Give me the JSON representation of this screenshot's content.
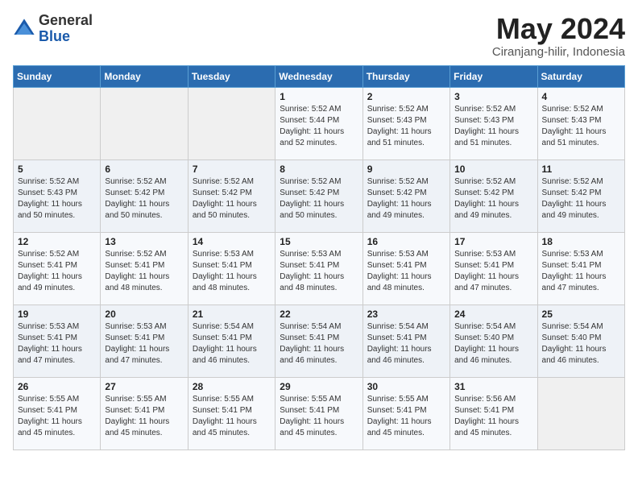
{
  "logo": {
    "general": "General",
    "blue": "Blue"
  },
  "title": "May 2024",
  "subtitle": "Ciranjang-hilir, Indonesia",
  "days": [
    "Sunday",
    "Monday",
    "Tuesday",
    "Wednesday",
    "Thursday",
    "Friday",
    "Saturday"
  ],
  "weeks": [
    [
      {
        "day": "",
        "content": ""
      },
      {
        "day": "",
        "content": ""
      },
      {
        "day": "",
        "content": ""
      },
      {
        "day": "1",
        "content": "Sunrise: 5:52 AM\nSunset: 5:44 PM\nDaylight: 11 hours\nand 52 minutes."
      },
      {
        "day": "2",
        "content": "Sunrise: 5:52 AM\nSunset: 5:43 PM\nDaylight: 11 hours\nand 51 minutes."
      },
      {
        "day": "3",
        "content": "Sunrise: 5:52 AM\nSunset: 5:43 PM\nDaylight: 11 hours\nand 51 minutes."
      },
      {
        "day": "4",
        "content": "Sunrise: 5:52 AM\nSunset: 5:43 PM\nDaylight: 11 hours\nand 51 minutes."
      }
    ],
    [
      {
        "day": "5",
        "content": "Sunrise: 5:52 AM\nSunset: 5:43 PM\nDaylight: 11 hours\nand 50 minutes."
      },
      {
        "day": "6",
        "content": "Sunrise: 5:52 AM\nSunset: 5:42 PM\nDaylight: 11 hours\nand 50 minutes."
      },
      {
        "day": "7",
        "content": "Sunrise: 5:52 AM\nSunset: 5:42 PM\nDaylight: 11 hours\nand 50 minutes."
      },
      {
        "day": "8",
        "content": "Sunrise: 5:52 AM\nSunset: 5:42 PM\nDaylight: 11 hours\nand 50 minutes."
      },
      {
        "day": "9",
        "content": "Sunrise: 5:52 AM\nSunset: 5:42 PM\nDaylight: 11 hours\nand 49 minutes."
      },
      {
        "day": "10",
        "content": "Sunrise: 5:52 AM\nSunset: 5:42 PM\nDaylight: 11 hours\nand 49 minutes."
      },
      {
        "day": "11",
        "content": "Sunrise: 5:52 AM\nSunset: 5:42 PM\nDaylight: 11 hours\nand 49 minutes."
      }
    ],
    [
      {
        "day": "12",
        "content": "Sunrise: 5:52 AM\nSunset: 5:41 PM\nDaylight: 11 hours\nand 49 minutes."
      },
      {
        "day": "13",
        "content": "Sunrise: 5:52 AM\nSunset: 5:41 PM\nDaylight: 11 hours\nand 48 minutes."
      },
      {
        "day": "14",
        "content": "Sunrise: 5:53 AM\nSunset: 5:41 PM\nDaylight: 11 hours\nand 48 minutes."
      },
      {
        "day": "15",
        "content": "Sunrise: 5:53 AM\nSunset: 5:41 PM\nDaylight: 11 hours\nand 48 minutes."
      },
      {
        "day": "16",
        "content": "Sunrise: 5:53 AM\nSunset: 5:41 PM\nDaylight: 11 hours\nand 48 minutes."
      },
      {
        "day": "17",
        "content": "Sunrise: 5:53 AM\nSunset: 5:41 PM\nDaylight: 11 hours\nand 47 minutes."
      },
      {
        "day": "18",
        "content": "Sunrise: 5:53 AM\nSunset: 5:41 PM\nDaylight: 11 hours\nand 47 minutes."
      }
    ],
    [
      {
        "day": "19",
        "content": "Sunrise: 5:53 AM\nSunset: 5:41 PM\nDaylight: 11 hours\nand 47 minutes."
      },
      {
        "day": "20",
        "content": "Sunrise: 5:53 AM\nSunset: 5:41 PM\nDaylight: 11 hours\nand 47 minutes."
      },
      {
        "day": "21",
        "content": "Sunrise: 5:54 AM\nSunset: 5:41 PM\nDaylight: 11 hours\nand 46 minutes."
      },
      {
        "day": "22",
        "content": "Sunrise: 5:54 AM\nSunset: 5:41 PM\nDaylight: 11 hours\nand 46 minutes."
      },
      {
        "day": "23",
        "content": "Sunrise: 5:54 AM\nSunset: 5:41 PM\nDaylight: 11 hours\nand 46 minutes."
      },
      {
        "day": "24",
        "content": "Sunrise: 5:54 AM\nSunset: 5:40 PM\nDaylight: 11 hours\nand 46 minutes."
      },
      {
        "day": "25",
        "content": "Sunrise: 5:54 AM\nSunset: 5:40 PM\nDaylight: 11 hours\nand 46 minutes."
      }
    ],
    [
      {
        "day": "26",
        "content": "Sunrise: 5:55 AM\nSunset: 5:41 PM\nDaylight: 11 hours\nand 45 minutes."
      },
      {
        "day": "27",
        "content": "Sunrise: 5:55 AM\nSunset: 5:41 PM\nDaylight: 11 hours\nand 45 minutes."
      },
      {
        "day": "28",
        "content": "Sunrise: 5:55 AM\nSunset: 5:41 PM\nDaylight: 11 hours\nand 45 minutes."
      },
      {
        "day": "29",
        "content": "Sunrise: 5:55 AM\nSunset: 5:41 PM\nDaylight: 11 hours\nand 45 minutes."
      },
      {
        "day": "30",
        "content": "Sunrise: 5:55 AM\nSunset: 5:41 PM\nDaylight: 11 hours\nand 45 minutes."
      },
      {
        "day": "31",
        "content": "Sunrise: 5:56 AM\nSunset: 5:41 PM\nDaylight: 11 hours\nand 45 minutes."
      },
      {
        "day": "",
        "content": ""
      }
    ]
  ]
}
